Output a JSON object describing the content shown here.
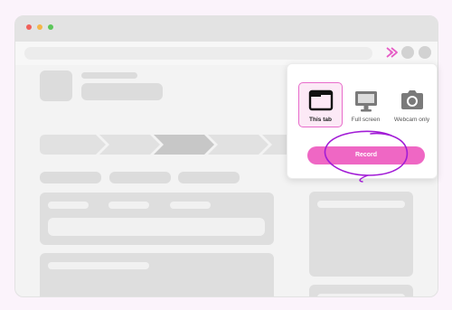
{
  "colors": {
    "accent": "#ef67c4",
    "accent_outline": "#e86ccb",
    "scribble": "#a21cd6",
    "background": "#fbf3fb"
  },
  "browser": {
    "traffic_lights": [
      "close",
      "minimize",
      "maximize"
    ],
    "extension_icon": "screen-recorder-icon"
  },
  "popup": {
    "options": [
      {
        "label": "This tab",
        "icon": "browser-tab-icon",
        "selected": true
      },
      {
        "label": "Full screen",
        "icon": "monitor-icon",
        "selected": false
      },
      {
        "label": "Webcam only",
        "icon": "camera-icon",
        "selected": false
      }
    ],
    "record_label": "Record"
  }
}
